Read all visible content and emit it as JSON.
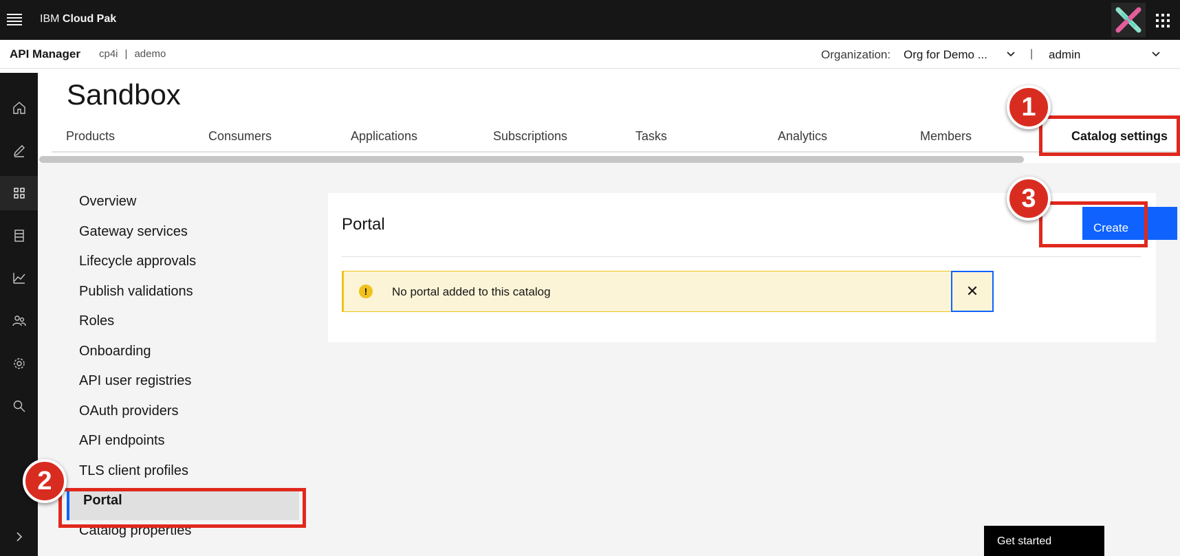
{
  "topbar": {
    "brand_prefix": "IBM",
    "brand_name": "Cloud Pak"
  },
  "subheader": {
    "app_name": "API Manager",
    "crumb_1": "cp4i",
    "crumb_sep": "|",
    "crumb_2": "ademo",
    "org_label": "Organization:",
    "org_value": "Org for Demo ...",
    "pipe": "|",
    "user": "admin"
  },
  "rail": {
    "icons": [
      "home-icon",
      "edit-icon",
      "apps-grid-icon",
      "catalog-icon",
      "analytics-icon",
      "users-icon",
      "settings-icon",
      "search-icon",
      "expand-icon"
    ],
    "active": "apps-grid-icon"
  },
  "page": {
    "title": "Sandbox"
  },
  "tabs": [
    {
      "label": "Products"
    },
    {
      "label": "Consumers"
    },
    {
      "label": "Applications"
    },
    {
      "label": "Subscriptions"
    },
    {
      "label": "Tasks"
    },
    {
      "label": "Analytics"
    },
    {
      "label": "Members"
    },
    {
      "label": "Catalog settings",
      "selected": true
    }
  ],
  "sidenav": [
    {
      "label": "Overview"
    },
    {
      "label": "Gateway services"
    },
    {
      "label": "Lifecycle approvals"
    },
    {
      "label": "Publish validations"
    },
    {
      "label": "Roles"
    },
    {
      "label": "Onboarding"
    },
    {
      "label": "API user registries"
    },
    {
      "label": "OAuth providers"
    },
    {
      "label": "API endpoints"
    },
    {
      "label": "TLS client profiles"
    },
    {
      "label": "Portal",
      "active": true
    },
    {
      "label": "Catalog properties"
    }
  ],
  "portal": {
    "title": "Portal",
    "create_label": "Create",
    "notice_text": "No portal added to this catalog",
    "warn_glyph": "!",
    "close_glyph": "✕"
  },
  "annotations": {
    "step_1": "1",
    "step_2": "2",
    "step_3": "3"
  },
  "footer": {
    "get_started": "Get started"
  },
  "colors": {
    "primary": "#0f62fe",
    "warning": "#f1c21b",
    "annotation_red": "#e0281d"
  }
}
